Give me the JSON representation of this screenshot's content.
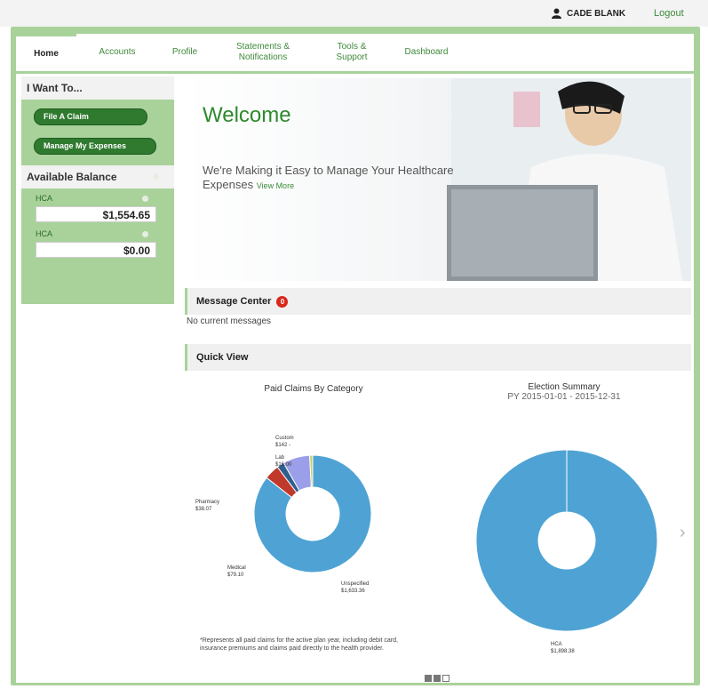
{
  "header": {
    "user_name": "CADE BLANK",
    "logout_label": "Logout"
  },
  "nav": {
    "tabs": [
      {
        "label": "Home",
        "active": true
      },
      {
        "label": "Accounts",
        "active": false
      },
      {
        "label": "Profile",
        "active": false
      },
      {
        "label": "Statements & Notifications",
        "active": false
      },
      {
        "label": "Tools & Support",
        "active": false
      },
      {
        "label": "Dashboard",
        "active": false
      }
    ]
  },
  "sidebar": {
    "i_want_to_title": "I Want To...",
    "file_claim_label": "File A Claim",
    "manage_expenses_label": "Manage My Expenses",
    "balance_title": "Available Balance",
    "accounts": [
      {
        "type": "HCA",
        "amount": "$1,554.65"
      },
      {
        "type": "HCA",
        "amount": "$0.00"
      }
    ]
  },
  "hero": {
    "title": "Welcome",
    "subtitle": "We're Making it Easy to Manage Your Healthcare Expenses",
    "link": "View More"
  },
  "message_center": {
    "title": "Message Center",
    "count": "0",
    "empty_text": "No current messages"
  },
  "quick_view": {
    "title": "Quick View",
    "left_chart_title": "Paid Claims By Category",
    "right_chart_title": "Election Summary",
    "right_chart_subtitle": "PY 2015-01-01 - 2015-12-31",
    "footnote": "*Represents all paid claims for the active plan year, including debit card, insurance premiums and claims paid directly to the health provider."
  },
  "chart_data": [
    {
      "type": "pie",
      "title": "Paid Claims By Category",
      "categories": [
        "Unspecified",
        "Medical",
        "Pharmacy",
        "Custom",
        "Lab"
      ],
      "values": [
        1633.36,
        79.1,
        38.07,
        142.0,
        16.0
      ],
      "value_labels": [
        "$1,633.36",
        "$79.10",
        "$38.07",
        "$142 -",
        "$16.00"
      ],
      "colors": [
        "#4ea3d4",
        "#c0392b",
        "#2e5f8f",
        "#9b9ee8",
        "#c4d36a"
      ]
    },
    {
      "type": "pie",
      "title": "Election Summary",
      "subtitle": "PY 2015-01-01 - 2015-12-31",
      "categories": [
        "HCA"
      ],
      "values": [
        1898.38
      ],
      "value_labels": [
        "$1,898.38"
      ],
      "colors": [
        "#4ea3d4"
      ]
    }
  ]
}
